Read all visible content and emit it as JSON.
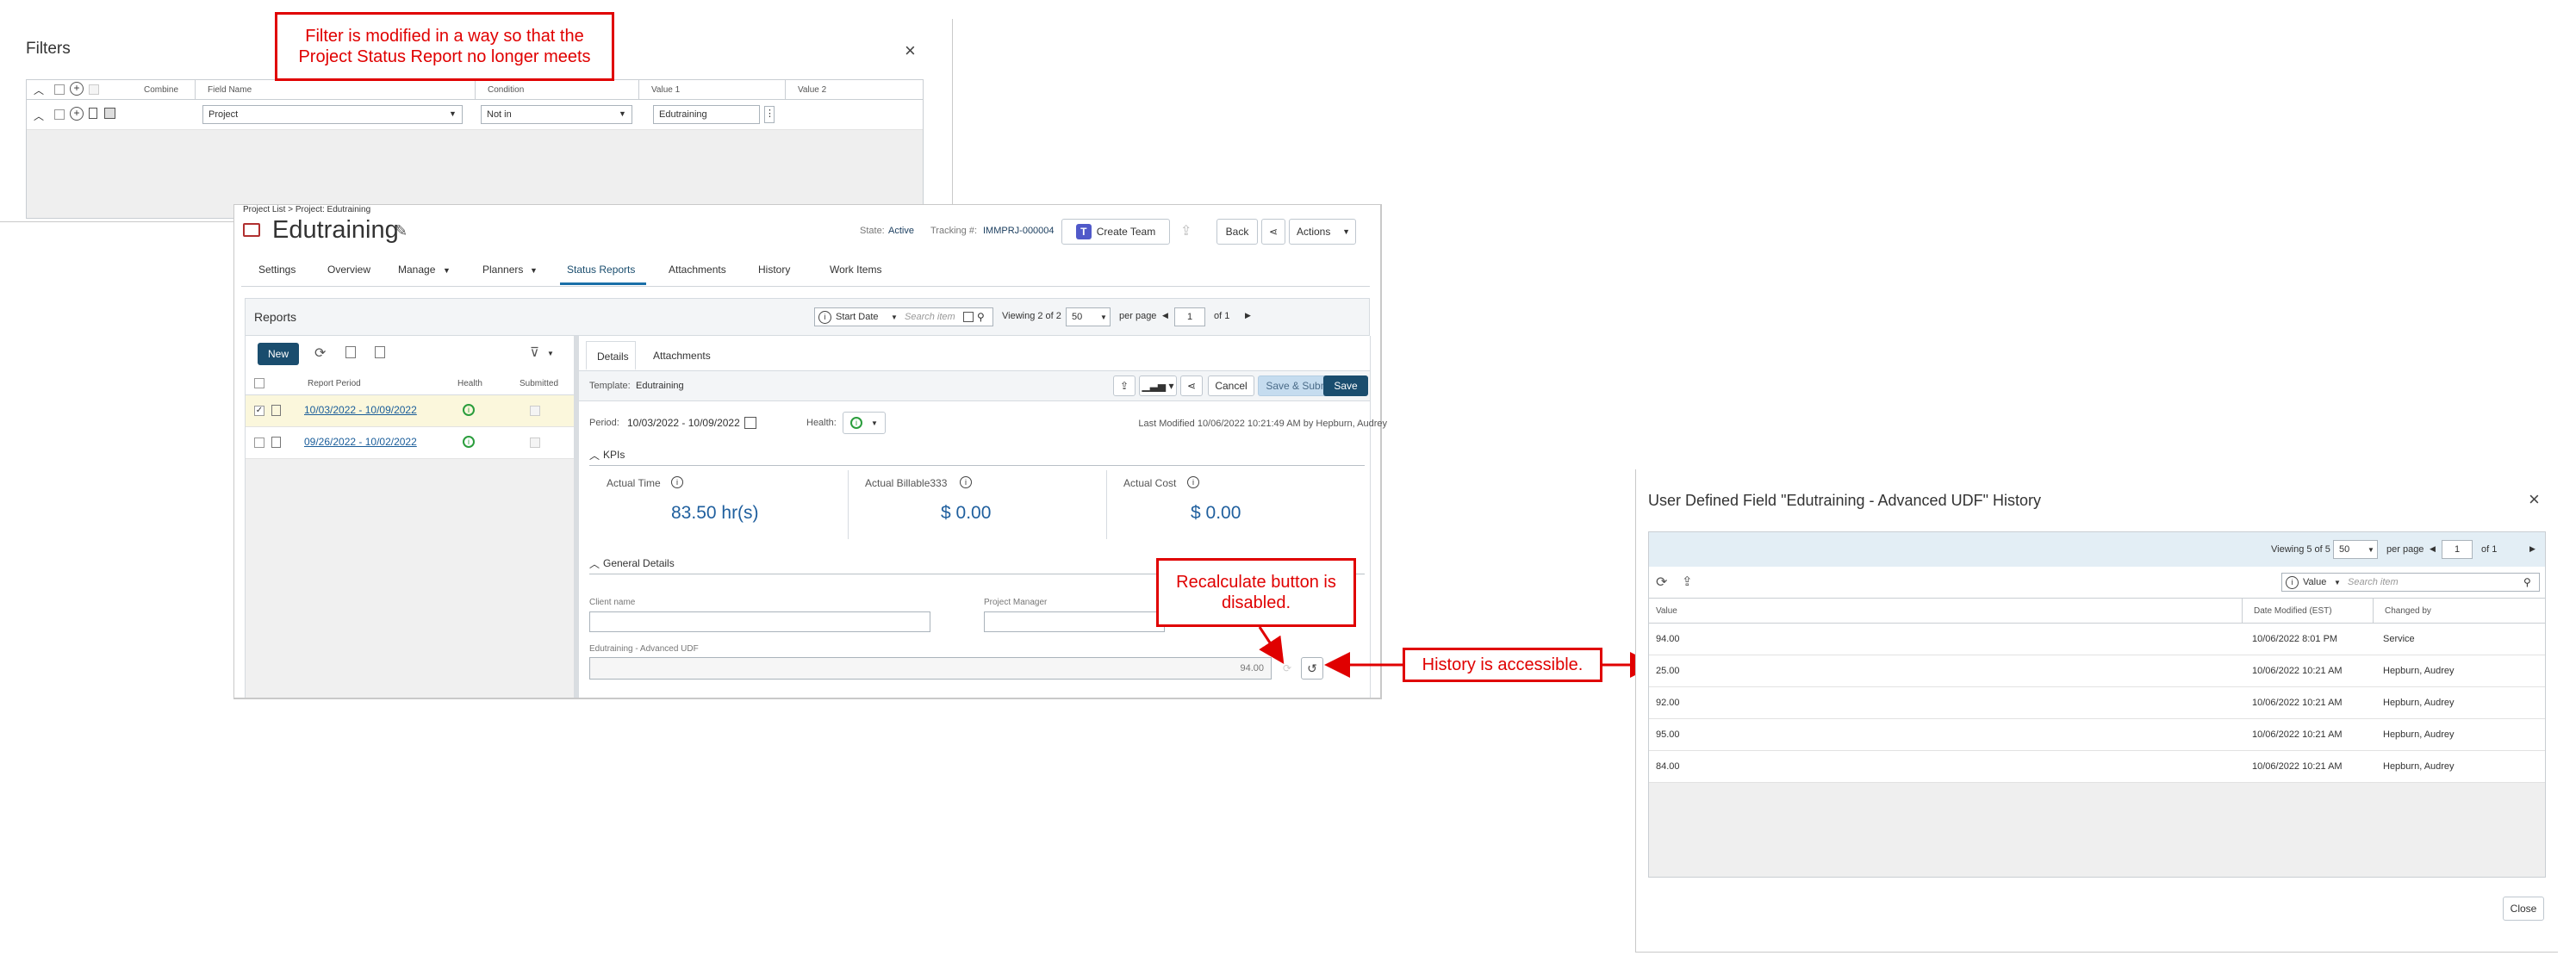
{
  "filters": {
    "title": "Filters",
    "columns": [
      "Combine",
      "Field Name",
      "Condition",
      "Value 1",
      "Value 2"
    ],
    "row": {
      "field": "Project",
      "condition": "Not in",
      "value1": "Edutraining"
    }
  },
  "project": {
    "breadcrumb": "Project List > Project: Edutraining",
    "name": "Edutraining",
    "state_label": "State:",
    "state_value": "Active",
    "tracking_label": "Tracking #:",
    "tracking_value": "IMMPRJ-000004",
    "create_team": "Create Team",
    "back": "Back",
    "actions": "Actions",
    "tabs": [
      "Settings",
      "Overview",
      "Manage",
      "Planners",
      "Status Reports",
      "Attachments",
      "History",
      "Work Items"
    ]
  },
  "reports": {
    "title": "Reports",
    "sort_label": "Start Date",
    "search_placeholder": "Search item",
    "viewing": "Viewing 2 of 2",
    "per_page_value": "50",
    "per_page_label": "per page",
    "page_value": "1",
    "page_of": "of 1",
    "new_button": "New",
    "columns": [
      "Report Period",
      "Health",
      "Submitted"
    ],
    "rows": [
      {
        "period": "10/03/2022 - 10/09/2022"
      },
      {
        "period": "09/26/2022 - 10/02/2022"
      }
    ]
  },
  "details": {
    "tabs": [
      "Details",
      "Attachments"
    ],
    "template_label": "Template:",
    "template_value": "Edutraining",
    "cancel": "Cancel",
    "save_submit": "Save & Submit",
    "save": "Save",
    "period_label": "Period:",
    "period_value": "10/03/2022 - 10/09/2022",
    "health_label": "Health:",
    "last_modified": "Last Modified 10/06/2022 10:21:49 AM by Hepburn, Audrey",
    "kpis_section": "KPIs",
    "kpis": [
      {
        "label": "Actual Time",
        "value": "83.50 hr(s)"
      },
      {
        "label": "Actual Billable333",
        "value": "$ 0.00"
      },
      {
        "label": "Actual Cost",
        "value": "$ 0.00"
      }
    ],
    "general_section": "General Details",
    "client_label": "Client name",
    "pm_label": "Project Manager",
    "udf_label": "Edutraining - Advanced UDF",
    "udf_value": "94.00"
  },
  "history": {
    "title": "User Defined Field \"Edutraining - Advanced UDF\" History",
    "viewing": "Viewing 5 of 5",
    "per_page_value": "50",
    "per_page_label": "per page",
    "page_value": "1",
    "page_of": "of 1",
    "sort_label": "Value",
    "search_placeholder": "Search item",
    "columns": [
      "Value",
      "Date Modified (EST)",
      "Changed by"
    ],
    "rows": [
      {
        "value": "94.00",
        "date": "10/06/2022 8:01 PM",
        "by": "Service"
      },
      {
        "value": "25.00",
        "date": "10/06/2022 10:21 AM",
        "by": "Hepburn, Audrey"
      },
      {
        "value": "92.00",
        "date": "10/06/2022 10:21 AM",
        "by": "Hepburn, Audrey"
      },
      {
        "value": "95.00",
        "date": "10/06/2022 10:21 AM",
        "by": "Hepburn, Audrey"
      },
      {
        "value": "84.00",
        "date": "10/06/2022 10:21 AM",
        "by": "Hepburn, Audrey"
      }
    ],
    "close": "Close"
  },
  "annotations": {
    "filter_note_line1": "Filter is modified in a way so that the",
    "filter_note_line2": "Project Status Report no longer meets",
    "recalc_line1": "Recalculate button is",
    "recalc_line2": "disabled.",
    "history_note": "History is accessible."
  },
  "colors": {
    "accent": "#1a4d6e",
    "link": "#1a5d9a",
    "annotation": "#e00000",
    "kpi_value": "#1f5f9e"
  }
}
